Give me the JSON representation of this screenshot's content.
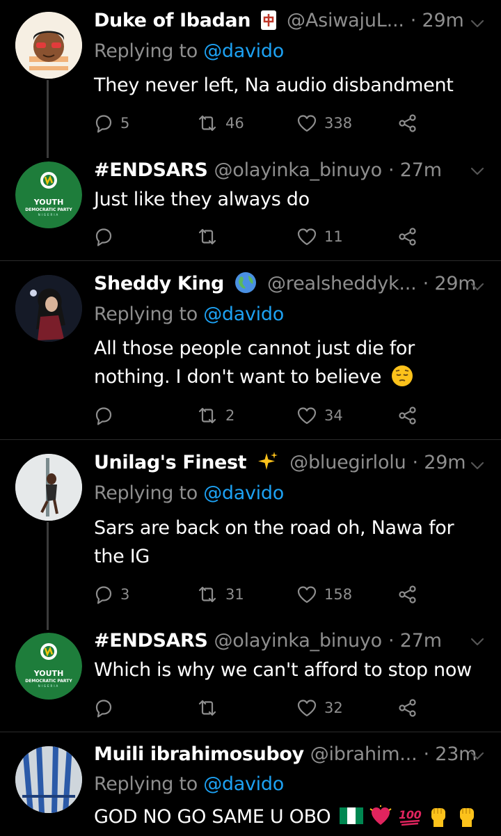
{
  "colors": {
    "background": "#000000",
    "text": "#ffffff",
    "muted": "#8e8e8e",
    "accent": "#1da1f2",
    "separator": "#2b2b2b"
  },
  "tweets": [
    {
      "name": "Duke of Ibadan",
      "name_emoji": "mahjong-red-dragon-icon",
      "handle": "@AsiwajuL...",
      "time": "· 29m",
      "replying_label": "Replying to ",
      "replying_to": "@davido",
      "text": "They never left, Na audio disbandment",
      "replies": "5",
      "retweets": "46",
      "likes": "338"
    },
    {
      "name": "#ENDSARS",
      "handle": "@olayinka_binuyo",
      "time": "· 27m",
      "avatar_text": "YOUTH",
      "avatar_subtext": "DEMOCRATIC PARTY",
      "avatar_small": "NIGERIA",
      "text": "Just like they always do",
      "replies": "",
      "retweets": "",
      "likes": "11"
    },
    {
      "name": "Sheddy King",
      "name_emoji": "globe-icon",
      "handle": "@realsheddyk...",
      "time": "· 29m",
      "replying_label": "Replying to ",
      "replying_to": "@davido",
      "text_line1": "All those people cannot just die for",
      "text_line2": "nothing. I don't want to believe",
      "text_emoji": "pensive-face-icon",
      "replies": "",
      "retweets": "2",
      "likes": "34"
    },
    {
      "name": "Unilag's Finest",
      "name_emoji": "sparkles-icon",
      "handle": "@bluegirlolu",
      "time": "· 29m",
      "replying_label": "Replying to ",
      "replying_to": "@davido",
      "text_line1": "Sars are back on the road oh, Nawa for",
      "text_line2": "the IG",
      "replies": "3",
      "retweets": "31",
      "likes": "158"
    },
    {
      "name": "#ENDSARS",
      "handle": "@olayinka_binuyo",
      "time": "· 27m",
      "avatar_text": "YOUTH",
      "avatar_subtext": "DEMOCRATIC PARTY",
      "avatar_small": "NIGERIA",
      "text": "Which is why we can't afford to stop now",
      "replies": "",
      "retweets": "",
      "likes": "32"
    },
    {
      "name": "Muili ibrahimosuboy",
      "handle": "@ibrahim...",
      "time": "· 23m",
      "replying_label": "Replying to ",
      "replying_to": "@davido",
      "text": "GOD NO GO SAME U OBO",
      "text_emojis": [
        "nigeria-flag-icon",
        "beating-heart-icon",
        "hundred-points-icon",
        "raised-fist-icon",
        "raised-fist-icon"
      ]
    }
  ]
}
